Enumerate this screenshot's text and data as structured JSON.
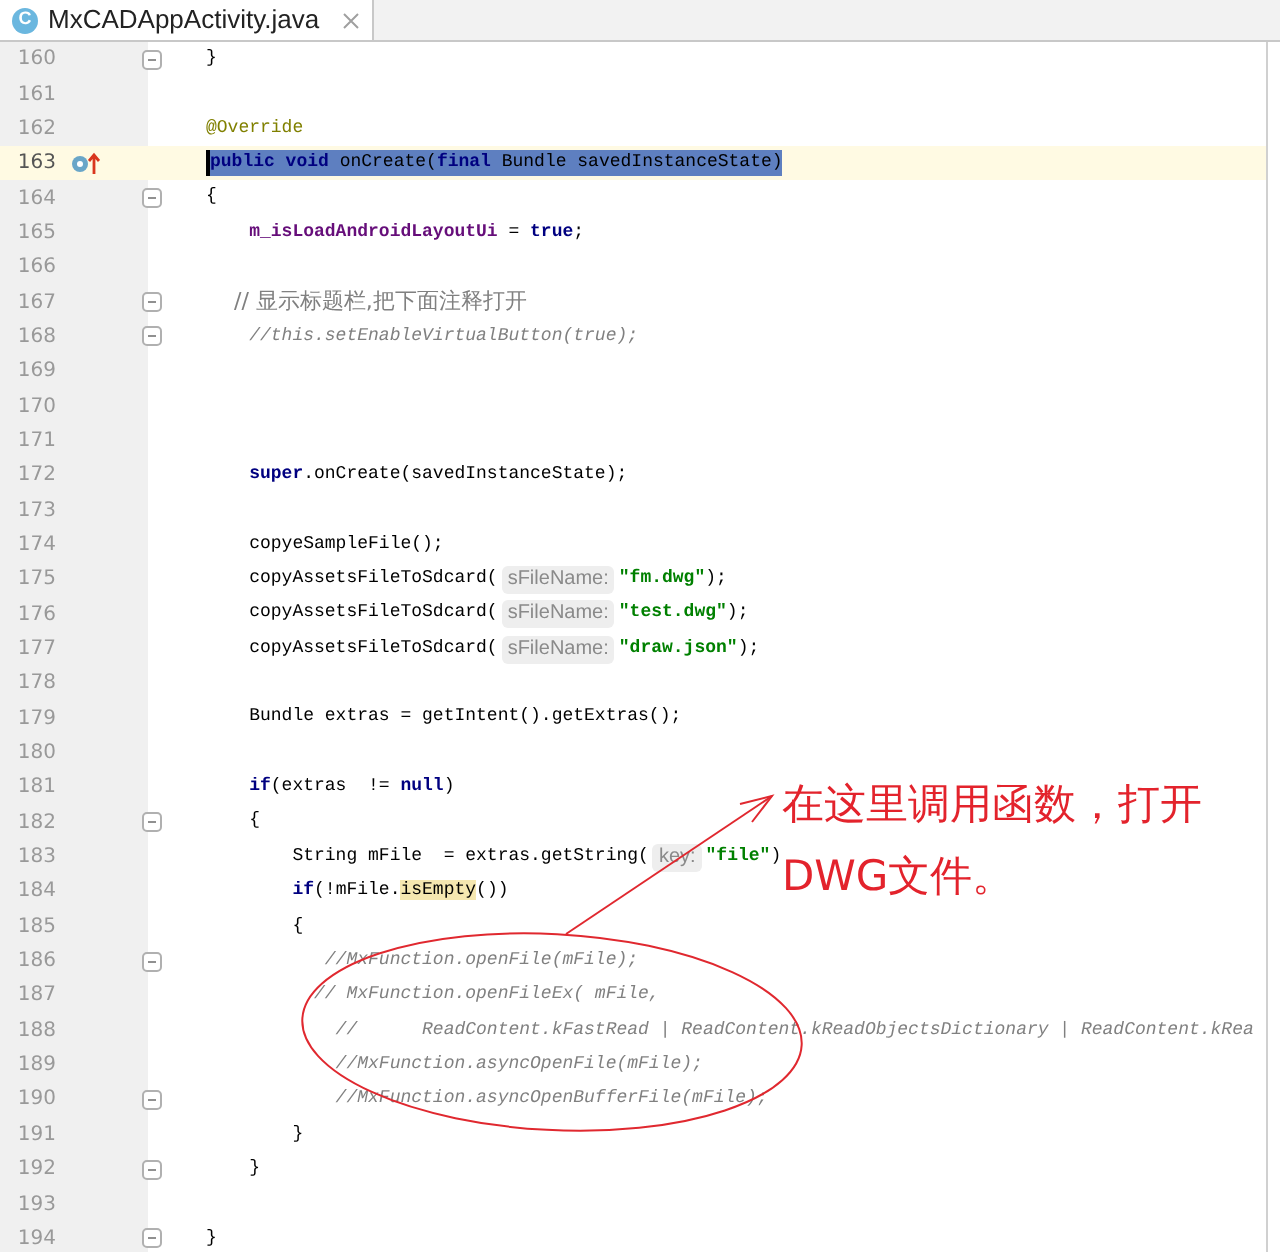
{
  "tab": {
    "icon_letter": "C",
    "title": "MxCADAppActivity.java",
    "selected": true
  },
  "lines": [
    {
      "number": "160",
      "fold": true,
      "current": false,
      "selected": false,
      "override_marker": false,
      "tokens": [
        {
          "t": "}",
          "kind": "plain"
        }
      ]
    },
    {
      "number": "161",
      "fold": false,
      "current": false,
      "selected": false,
      "override_marker": false
    },
    {
      "number": "162",
      "fold": false,
      "current": false,
      "selected": false,
      "override_marker": false,
      "tokens": [
        {
          "t": "@Override",
          "kind": "annotation"
        }
      ]
    },
    {
      "number": "163",
      "fold": false,
      "current": true,
      "selected": true,
      "override_marker": true,
      "tokens": [
        {
          "t": "public",
          "kind": "keyword"
        },
        {
          "t": " void",
          "kind": "keyword"
        },
        {
          "t": " onCreate(",
          "kind": "plain"
        },
        {
          "t": "final",
          "kind": "keyword"
        },
        {
          "t": " Bundle savedInstanceState)",
          "kind": "plain"
        }
      ]
    },
    {
      "number": "164",
      "fold": true,
      "current": false,
      "selected": false,
      "override_marker": false,
      "tokens": [
        {
          "t": "{",
          "kind": "plain"
        }
      ]
    },
    {
      "number": "165",
      "fold": false,
      "current": false,
      "selected": false,
      "override_marker": false,
      "tokens": [
        {
          "t": "    m_isLoadAndroidLayoutUi",
          "kind": "field"
        },
        {
          "t": " = ",
          "kind": "plain"
        },
        {
          "t": "true",
          "kind": "keyword"
        },
        {
          "t": ";",
          "kind": "plain"
        }
      ]
    },
    {
      "number": "166",
      "fold": false,
      "current": false,
      "selected": false,
      "override_marker": false
    },
    {
      "number": "167",
      "fold": true,
      "current": false,
      "selected": false,
      "override_marker": false,
      "tokens": [
        {
          "t": "    // 显示标题栏,把下面注释打开",
          "kind": "comment_cjk"
        }
      ]
    },
    {
      "number": "168",
      "fold": true,
      "current": false,
      "selected": false,
      "override_marker": false,
      "tokens": [
        {
          "t": "    //this.setEnableVirtualButton(true);",
          "kind": "comment"
        }
      ]
    },
    {
      "number": "169",
      "fold": false,
      "current": false,
      "selected": false,
      "override_marker": false
    },
    {
      "number": "170",
      "fold": false,
      "current": false,
      "selected": false,
      "override_marker": false
    },
    {
      "number": "171",
      "fold": false,
      "current": false,
      "selected": false,
      "override_marker": false
    },
    {
      "number": "172",
      "fold": false,
      "current": false,
      "selected": false,
      "override_marker": false,
      "tokens": [
        {
          "t": "    super",
          "kind": "keyword"
        },
        {
          "t": ".onCreate(savedInstanceState);",
          "kind": "plain"
        }
      ]
    },
    {
      "number": "173",
      "fold": false,
      "current": false,
      "selected": false,
      "override_marker": false
    },
    {
      "number": "174",
      "fold": false,
      "current": false,
      "selected": false,
      "override_marker": false,
      "tokens": [
        {
          "t": "    copyeSampleFile();",
          "kind": "plain"
        }
      ]
    },
    {
      "number": "175",
      "fold": false,
      "current": false,
      "selected": false,
      "override_marker": false,
      "tokens": [
        {
          "t": "    copyAssetsFileToSdcard(",
          "kind": "plain"
        },
        {
          "t": "sFileName:",
          "kind": "hint"
        },
        {
          "t": "\"fm.dwg\"",
          "kind": "string"
        },
        {
          "t": ");",
          "kind": "plain"
        }
      ]
    },
    {
      "number": "176",
      "fold": false,
      "current": false,
      "selected": false,
      "override_marker": false,
      "tokens": [
        {
          "t": "    copyAssetsFileToSdcard(",
          "kind": "plain"
        },
        {
          "t": "sFileName:",
          "kind": "hint"
        },
        {
          "t": "\"test.dwg\"",
          "kind": "string"
        },
        {
          "t": ");",
          "kind": "plain"
        }
      ]
    },
    {
      "number": "177",
      "fold": false,
      "current": false,
      "selected": false,
      "override_marker": false,
      "tokens": [
        {
          "t": "    copyAssetsFileToSdcard(",
          "kind": "plain"
        },
        {
          "t": "sFileName:",
          "kind": "hint"
        },
        {
          "t": "\"draw.json\"",
          "kind": "string"
        },
        {
          "t": ");",
          "kind": "plain"
        }
      ]
    },
    {
      "number": "178",
      "fold": false,
      "current": false,
      "selected": false,
      "override_marker": false
    },
    {
      "number": "179",
      "fold": false,
      "current": false,
      "selected": false,
      "override_marker": false,
      "tokens": [
        {
          "t": "    Bundle extras = getIntent().getExtras();",
          "kind": "plain"
        }
      ]
    },
    {
      "number": "180",
      "fold": false,
      "current": false,
      "selected": false,
      "override_marker": false
    },
    {
      "number": "181",
      "fold": false,
      "current": false,
      "selected": false,
      "override_marker": false,
      "tokens": [
        {
          "t": "    if",
          "kind": "keyword"
        },
        {
          "t": "(extras  != ",
          "kind": "plain"
        },
        {
          "t": "null",
          "kind": "keyword"
        },
        {
          "t": ")",
          "kind": "plain"
        }
      ]
    },
    {
      "number": "182",
      "fold": true,
      "current": false,
      "selected": false,
      "override_marker": false,
      "tokens": [
        {
          "t": "    {",
          "kind": "plain"
        }
      ]
    },
    {
      "number": "183",
      "fold": false,
      "current": false,
      "selected": false,
      "override_marker": false,
      "tokens": [
        {
          "t": "        String mFile  = extras.getString(",
          "kind": "plain"
        },
        {
          "t": "key:",
          "kind": "hint"
        },
        {
          "t": "\"file\"",
          "kind": "string"
        },
        {
          "t": ")",
          "kind": "plain"
        }
      ]
    },
    {
      "number": "184",
      "fold": false,
      "current": false,
      "selected": false,
      "override_marker": false,
      "tokens": [
        {
          "t": "        if",
          "kind": "keyword"
        },
        {
          "t": "(!mFile.",
          "kind": "plain"
        },
        {
          "t": "isEmpty",
          "kind": "usage"
        },
        {
          "t": "())",
          "kind": "plain"
        }
      ]
    },
    {
      "number": "185",
      "fold": false,
      "current": false,
      "selected": false,
      "override_marker": false,
      "tokens": [
        {
          "t": "        {",
          "kind": "plain"
        }
      ]
    },
    {
      "number": "186",
      "fold": true,
      "current": false,
      "selected": false,
      "override_marker": false,
      "tokens": [
        {
          "t": "           //MxFunction.openFile(mFile);",
          "kind": "comment"
        }
      ]
    },
    {
      "number": "187",
      "fold": false,
      "current": false,
      "selected": false,
      "override_marker": false,
      "tokens": [
        {
          "t": "          // MxFunction.openFileEx( mFile,",
          "kind": "comment"
        }
      ]
    },
    {
      "number": "188",
      "fold": false,
      "current": false,
      "selected": false,
      "override_marker": false,
      "tokens": [
        {
          "t": "            //      ReadContent.kFastRead | ReadContent.kReadObjectsDictionary | ReadContent.kRea",
          "kind": "comment"
        }
      ]
    },
    {
      "number": "189",
      "fold": false,
      "current": false,
      "selected": false,
      "override_marker": false,
      "tokens": [
        {
          "t": "            //MxFunction.asyncOpenFile(mFile);",
          "kind": "comment"
        }
      ]
    },
    {
      "number": "190",
      "fold": true,
      "current": false,
      "selected": false,
      "override_marker": false,
      "tokens": [
        {
          "t": "            //MxFunction.asyncOpenBufferFile(mFile);",
          "kind": "comment"
        }
      ]
    },
    {
      "number": "191",
      "fold": false,
      "current": false,
      "selected": false,
      "override_marker": false,
      "tokens": [
        {
          "t": "        }",
          "kind": "plain"
        }
      ]
    },
    {
      "number": "192",
      "fold": true,
      "current": false,
      "selected": false,
      "override_marker": false,
      "tokens": [
        {
          "t": "    }",
          "kind": "plain"
        }
      ]
    },
    {
      "number": "193",
      "fold": false,
      "current": false,
      "selected": false,
      "override_marker": false
    },
    {
      "number": "194",
      "fold": true,
      "current": false,
      "selected": false,
      "override_marker": false,
      "tokens": [
        {
          "t": "}",
          "kind": "plain"
        }
      ]
    }
  ],
  "callout": {
    "lines": [
      "在这里调用函数，打开",
      "DWG文件。"
    ]
  }
}
